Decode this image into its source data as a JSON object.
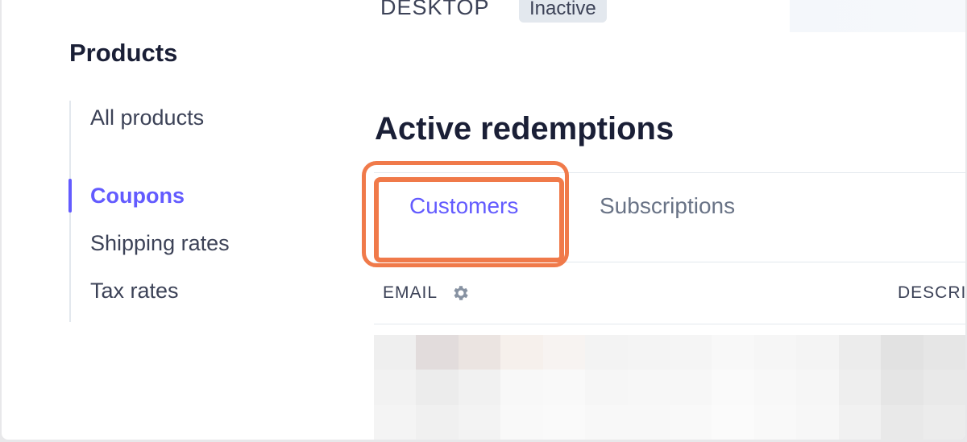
{
  "header": {
    "platform_label": "DESKTOP",
    "status_badge": "Inactive"
  },
  "sidebar": {
    "title": "Products",
    "items": [
      {
        "label": "All products",
        "active": false
      },
      {
        "label": "Coupons",
        "active": true
      },
      {
        "label": "Shipping rates",
        "active": false
      },
      {
        "label": "Tax rates",
        "active": false
      }
    ]
  },
  "main": {
    "section_title": "Active redemptions",
    "tabs": [
      {
        "label": "Customers",
        "active": true
      },
      {
        "label": "Subscriptions",
        "active": false
      }
    ],
    "table": {
      "columns": [
        "EMAIL",
        "DESCRI"
      ]
    }
  },
  "colors": {
    "accent": "#635bff",
    "highlight": "#f07a4a",
    "text_primary": "#1a1f36",
    "text_secondary": "#697386"
  },
  "icons": {
    "column_settings": "gear-icon"
  }
}
